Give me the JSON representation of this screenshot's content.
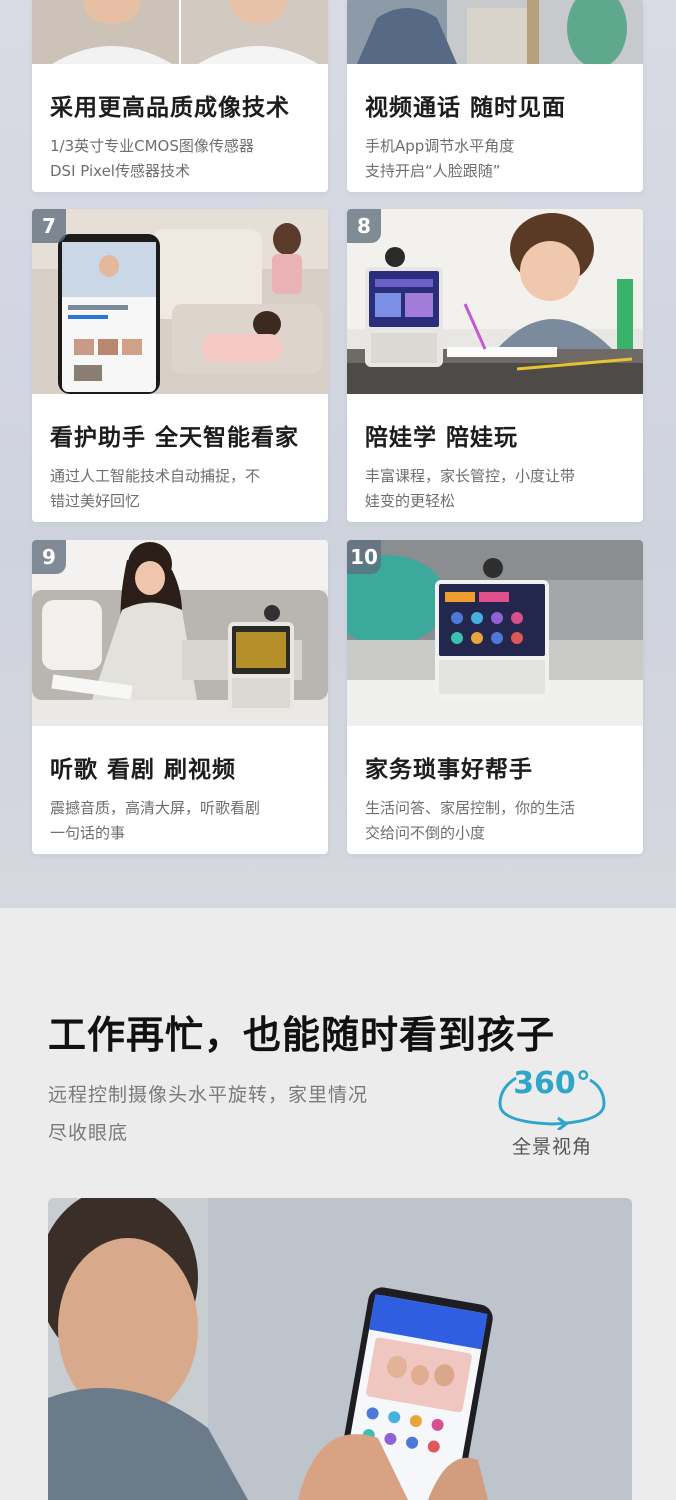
{
  "cards": [
    {
      "num": "",
      "title": "采用更高品质成像技术",
      "desc_lines": [
        "1/3英寸专业CMOS图像传感器",
        "DSI Pixel传感器技术"
      ]
    },
    {
      "num": "",
      "title": "视频通话 随时见面",
      "desc_lines": [
        "手机App调节水平角度",
        "支持开启“人脸跟随”"
      ]
    },
    {
      "num": "7",
      "title": "看护助手 全天智能看家",
      "desc_lines": [
        "通过人工智能技术自动捕捉，不",
        "错过美好回忆"
      ]
    },
    {
      "num": "8",
      "title": "陪娃学 陪娃玩",
      "desc_lines": [
        "丰富课程，家长管控，小度让带",
        "娃变的更轻松"
      ]
    },
    {
      "num": "9",
      "title": "听歌 看剧 刷视频",
      "desc_lines": [
        "震撼音质，高清大屏，听歌看剧",
        "一句话的事"
      ]
    },
    {
      "num": "10",
      "title": "家务琐事好帮手",
      "desc_lines": [
        "生活问答、家居控制，你的生活",
        "交给问不倒的小度"
      ]
    }
  ],
  "section": {
    "title": "工作再忙，也能随时看到孩子",
    "desc_lines": [
      "远程控制摄像头水平旋转，家里情况",
      "尽收眼底"
    ],
    "badge_value": "360°",
    "badge_label": "全景视角"
  },
  "colors": {
    "accent": "#2fa6c9",
    "badge": "#5f6e7d"
  }
}
